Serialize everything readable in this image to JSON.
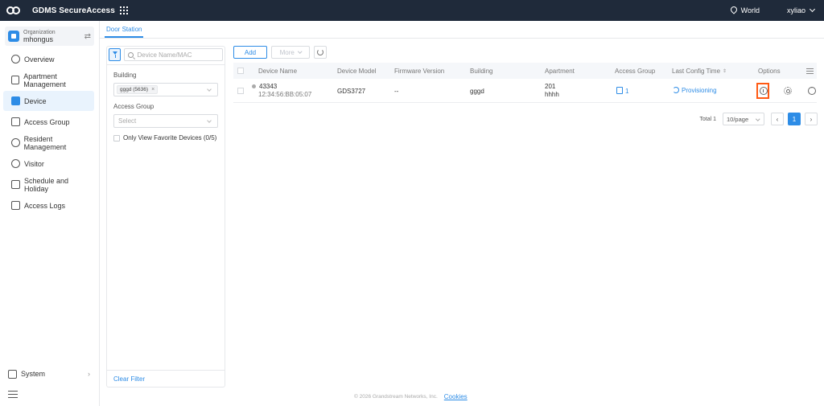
{
  "header": {
    "app_title": "GDMS SecureAccess",
    "location": "World",
    "user": "xyliao"
  },
  "sidebar": {
    "org_label": "Organization",
    "org_name": "mhongus",
    "items": [
      {
        "label": "Overview",
        "icon": "pie-chart-icon"
      },
      {
        "label": "Apartment Management",
        "icon": "building-icon"
      },
      {
        "label": "Device",
        "icon": "device-icon",
        "active": true
      },
      {
        "label": "Access Group",
        "icon": "access-group-icon"
      },
      {
        "label": "Resident Management",
        "icon": "resident-icon"
      },
      {
        "label": "Visitor",
        "icon": "visitor-icon"
      },
      {
        "label": "Schedule and Holiday",
        "icon": "calendar-icon"
      },
      {
        "label": "Access Logs",
        "icon": "log-icon"
      }
    ],
    "system_label": "System"
  },
  "tabs": {
    "active": "Door Station"
  },
  "filter": {
    "search_placeholder": "Device Name/MAC",
    "building_label": "Building",
    "building_chip": "gggd (5636)",
    "access_group_label": "Access Group",
    "access_group_placeholder": "Select",
    "favorite_label": "Only View Favorite Devices (0/5)",
    "clear_filter": "Clear Filter"
  },
  "toolbar": {
    "add_label": "Add",
    "more_label": "More"
  },
  "table": {
    "columns": {
      "device_name": "Device Name",
      "device_model": "Device Model",
      "firmware": "Firmware Version",
      "building": "Building",
      "apartment": "Apartment",
      "access_group": "Access Group",
      "last_config": "Last Config Time",
      "options": "Options"
    },
    "rows": [
      {
        "name": "43343",
        "mac": "12:34:56:BB:05:07",
        "model": "GDS3727",
        "firmware": "--",
        "building": "gggd",
        "apartment_num": "201",
        "apartment_name": "hhhh",
        "access_group": "1",
        "status": "Provisioning"
      }
    ]
  },
  "pagination": {
    "total": "Total 1",
    "page_size": "10/page",
    "current_page": "1"
  },
  "footer": {
    "copyright": "© 2026 Grandstream Networks, Inc.",
    "cookies": "Cookies"
  },
  "colors": {
    "accent": "#2d8ce6",
    "topbar": "#1f2a3a",
    "highlight": "#ff5a14"
  }
}
